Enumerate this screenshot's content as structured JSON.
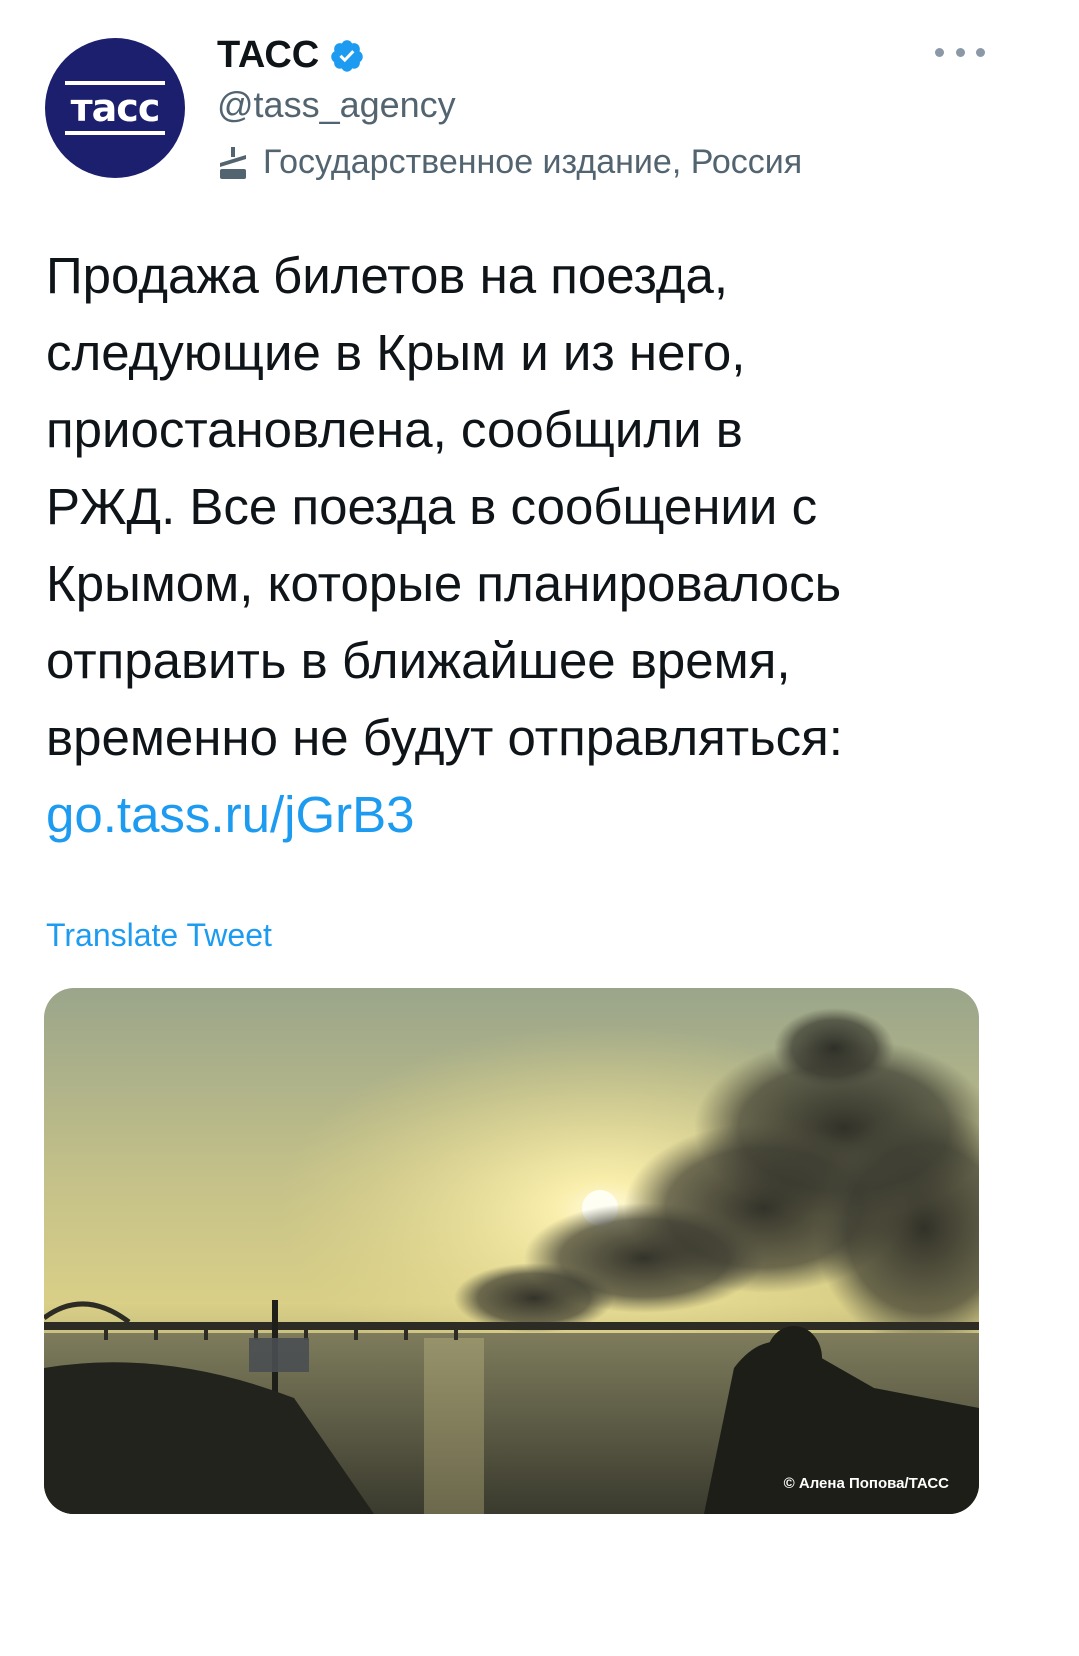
{
  "author": {
    "display_name": "ТАСС",
    "handle": "@tass_agency",
    "label": "Государственное издание, Россия",
    "avatar_text": "тасс"
  },
  "tweet": {
    "lines": [
      "Продажа билетов на поезда,",
      "следующие в Крым и из него,",
      "приостановлена, сообщили в",
      "РЖД. Все поезда в сообщении с",
      "Крымом, которые планировалось",
      "отправить в ближайшее время,",
      "временно не будут отправляться:"
    ],
    "link": "go.tass.ru/jGrB3"
  },
  "translate_label": "Translate Tweet",
  "media": {
    "credit": "© Алена Попова/ТАСС"
  },
  "colors": {
    "link": "#1d9bf0",
    "verified": "#1d9bf0",
    "avatar_bg": "#1b1f6e"
  }
}
